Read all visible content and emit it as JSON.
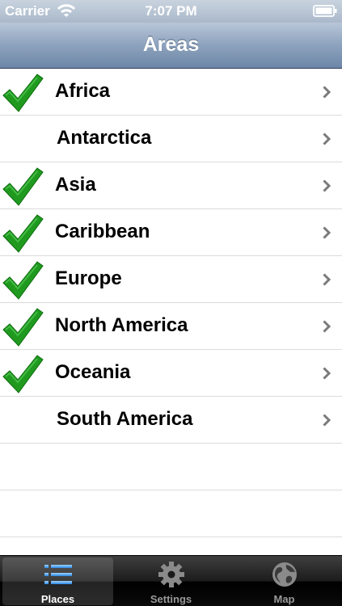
{
  "status": {
    "carrier": "Carrier",
    "time": "7:07 PM"
  },
  "nav": {
    "title": "Areas"
  },
  "areas": [
    {
      "label": "Africa",
      "checked": true
    },
    {
      "label": "Antarctica",
      "checked": false
    },
    {
      "label": "Asia",
      "checked": true
    },
    {
      "label": "Caribbean",
      "checked": true
    },
    {
      "label": "Europe",
      "checked": true
    },
    {
      "label": "North America",
      "checked": true
    },
    {
      "label": "Oceania",
      "checked": true
    },
    {
      "label": "South America",
      "checked": false
    }
  ],
  "tabs": [
    {
      "label": "Places",
      "icon": "list-icon",
      "selected": true
    },
    {
      "label": "Settings",
      "icon": "gear-icon",
      "selected": false
    },
    {
      "label": "Map",
      "icon": "globe-icon",
      "selected": false
    }
  ],
  "colors": {
    "check": "#1f9a1f",
    "chevron": "#7a7a7a",
    "nav_bar": "#8da2bd",
    "tab_bar": "#1c1c1c"
  }
}
